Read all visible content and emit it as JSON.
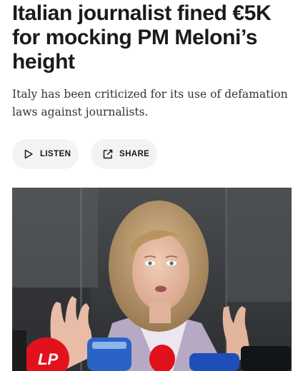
{
  "article": {
    "headline": "Italian journalist fined €5K for mocking PM Meloni’s height",
    "subheadline": "Italy has been criticized for its use of defamation laws against journalists."
  },
  "actions": {
    "listen_label": "LISTEN",
    "share_label": "SHARE",
    "listen_icon": "play-outline-icon",
    "share_icon": "share-external-icon"
  },
  "photo": {
    "description_icon": "photo",
    "microphone_logo": "LP"
  }
}
